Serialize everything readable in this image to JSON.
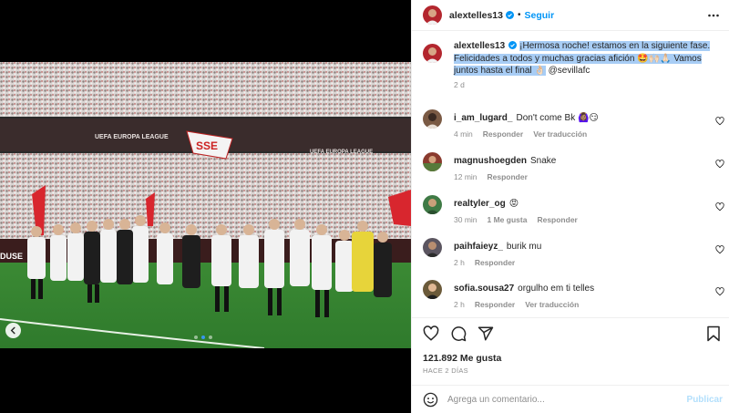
{
  "post_author": {
    "username": "alextelles13",
    "follow_label": "Seguir",
    "separator": "•"
  },
  "media": {
    "banner_text_left": "UEFA EUROPA LEAGUE",
    "banner_text_right": "UEFA EUROPA LEAGUE",
    "flag_text": "SSE",
    "board_text_left": "DUSE",
    "carousel_dots": 3,
    "active_dot": 1
  },
  "caption": {
    "username": "alextelles13",
    "text": "¡Hermosa noche! estamos en la siguiente fase. Felicidades a todos y muchas gracias afición 🤩🙌🏻🙏🏻 Vamos juntos hasta el final 👌🏻",
    "mention": "@sevillafc",
    "time": "2 d"
  },
  "comments": [
    {
      "username": "i_am_lugard_",
      "text": "Don't come Bk 🙆🏽‍♀️😏",
      "time": "4 min",
      "reply_label": "Responder",
      "translate_label": "Ver traducción",
      "avatar_color": "#7a5a44"
    },
    {
      "username": "magnushoegden",
      "text": "Snake",
      "time": "12 min",
      "reply_label": "Responder",
      "translate_label": "",
      "avatar_color": "#8a3a2e"
    },
    {
      "username": "realtyler_og",
      "text": "😡",
      "time": "30 min",
      "likes_label": "1 Me gusta",
      "reply_label": "Responder",
      "translate_label": "",
      "avatar_color": "#3f7a45"
    },
    {
      "username": "paihfaieyz_",
      "text": "burik mu",
      "time": "2 h",
      "reply_label": "Responder",
      "translate_label": "",
      "avatar_color": "#5b5560"
    },
    {
      "username": "sofia.sousa27",
      "text": "orgulho em ti telles",
      "time": "2 h",
      "reply_label": "Responder",
      "translate_label": "Ver traducción",
      "avatar_color": "#6b5a3a"
    }
  ],
  "actions": {
    "likes": "121.892 Me gusta",
    "post_time": "HACE 2 DÍAS",
    "comment_placeholder": "Agrega un comentario...",
    "publish_label": "Publicar"
  },
  "icons": {
    "verified": "verified-badge-icon",
    "more": "more-options-icon",
    "like": "heart-icon",
    "comment": "comment-icon",
    "share": "share-icon",
    "save": "bookmark-icon",
    "emoji": "emoji-icon",
    "carousel_prev": "chevron-left-icon"
  },
  "colors": {
    "accent": "#0095f6",
    "selection": "#a8cdf5",
    "publish_disabled": "#b2dffc",
    "secondary_text": "#8e8e8e"
  }
}
